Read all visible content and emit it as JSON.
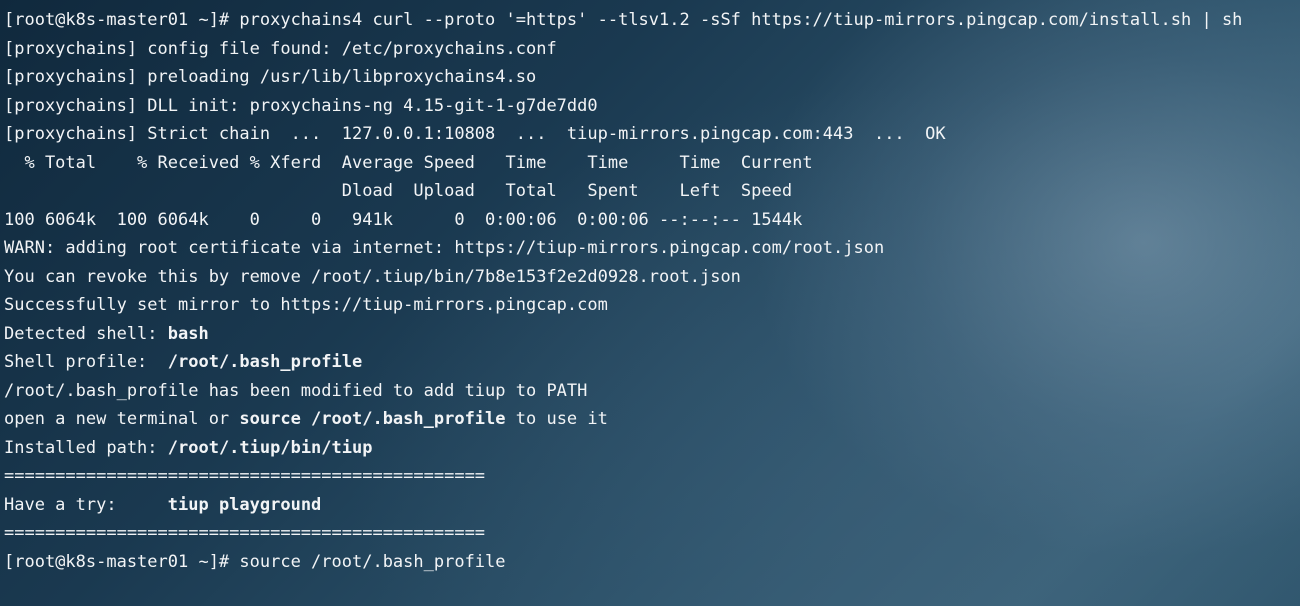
{
  "terminal": {
    "lines": [
      [
        {
          "t": "[root@k8s-master01 ~]# proxychains4 curl --proto '=https' --tlsv1.2 -sSf https://tiup-mirrors.pingcap.com/install.sh | sh"
        }
      ],
      [
        {
          "t": "[proxychains] config file found: /etc/proxychains.conf"
        }
      ],
      [
        {
          "t": "[proxychains] preloading /usr/lib/libproxychains4.so"
        }
      ],
      [
        {
          "t": "[proxychains] DLL init: proxychains-ng 4.15-git-1-g7de7dd0"
        }
      ],
      [
        {
          "t": "[proxychains] Strict chain  ...  127.0.0.1:10808  ...  tiup-mirrors.pingcap.com:443  ...  OK"
        }
      ],
      [
        {
          "t": "  % Total    % Received % Xferd  Average Speed   Time    Time     Time  Current"
        }
      ],
      [
        {
          "t": "                                 Dload  Upload   Total   Spent    Left  Speed"
        }
      ],
      [
        {
          "t": "100 6064k  100 6064k    0     0   941k      0  0:00:06  0:00:06 --:--:-- 1544k"
        }
      ],
      [
        {
          "t": "WARN: adding root certificate via internet: https://tiup-mirrors.pingcap.com/root.json"
        }
      ],
      [
        {
          "t": "You can revoke this by remove /root/.tiup/bin/7b8e153f2e2d0928.root.json"
        }
      ],
      [
        {
          "t": "Successfully set mirror to https://tiup-mirrors.pingcap.com"
        }
      ],
      [
        {
          "t": "Detected shell: "
        },
        {
          "t": "bash",
          "b": true
        }
      ],
      [
        {
          "t": "Shell profile:  "
        },
        {
          "t": "/root/.bash_profile",
          "b": true
        }
      ],
      [
        {
          "t": "/root/.bash_profile has been modified to add tiup to PATH"
        }
      ],
      [
        {
          "t": "open a new terminal or "
        },
        {
          "t": "source /root/.bash_profile",
          "b": true
        },
        {
          "t": " to use it"
        }
      ],
      [
        {
          "t": "Installed path: "
        },
        {
          "t": "/root/.tiup/bin/tiup",
          "b": true
        }
      ],
      [
        {
          "t": "==============================================="
        }
      ],
      [
        {
          "t": "Have a try:     "
        },
        {
          "t": "tiup playground",
          "b": true
        }
      ],
      [
        {
          "t": "==============================================="
        }
      ],
      [
        {
          "t": "[root@k8s-master01 ~]# source /root/.bash_profile"
        }
      ]
    ]
  },
  "colors": {
    "text": "#f2f4f6",
    "background_dark": "#10293d",
    "background_light": "#3e667d"
  }
}
